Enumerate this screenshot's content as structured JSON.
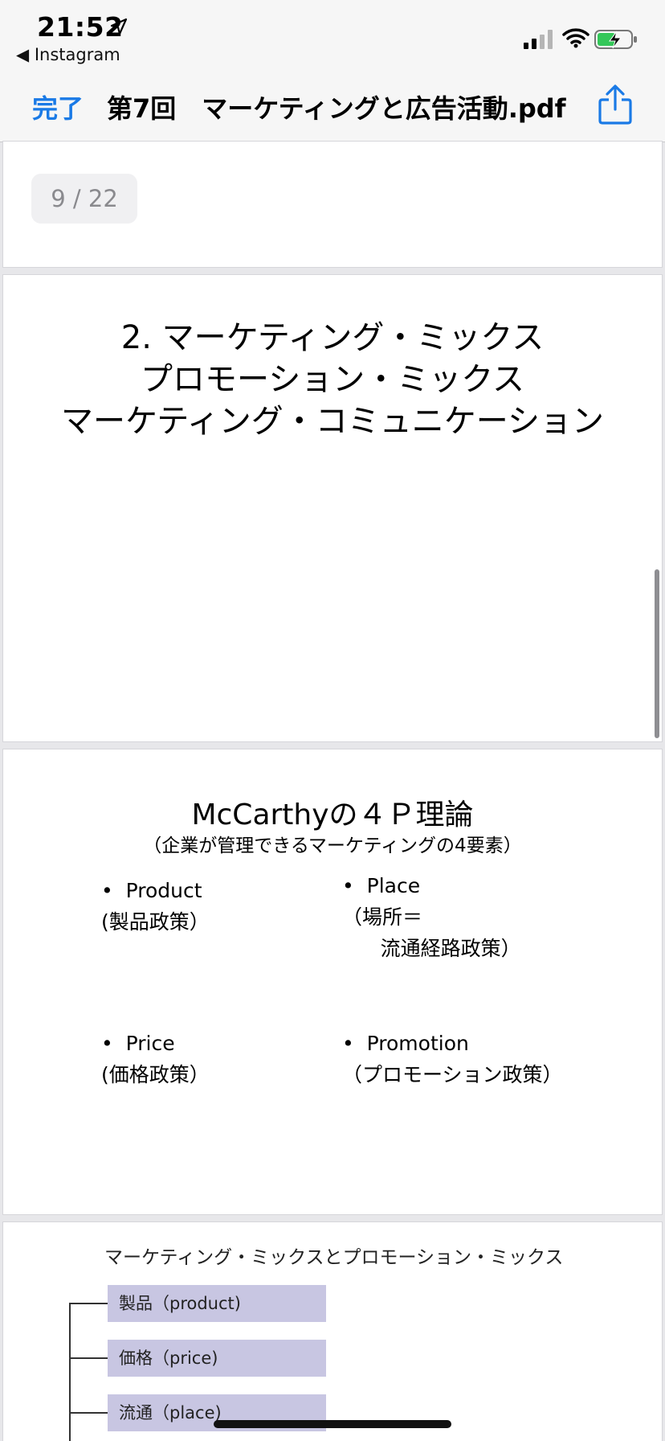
{
  "status_bar": {
    "time": "21:52",
    "back_app": "◀ Instagram",
    "icons": [
      "location-arrow-icon",
      "cellular-signal-icon",
      "wifi-icon",
      "battery-charging-icon"
    ]
  },
  "nav": {
    "done_label": "完了",
    "title": "第7回　マーケティングと広告活動.pdf",
    "share_icon": "share-icon",
    "accent_color": "#1a7ae6"
  },
  "viewer": {
    "page_indicator": "9 / 22"
  },
  "slides": {
    "slide2": {
      "lines": [
        "2. マーケティング・ミックス",
        "プロモーション・ミックス",
        "マーケティング・コミュニケーション"
      ]
    },
    "slide3": {
      "title": "McCarthyの４Ｐ理論",
      "subtitle": "（企業が管理できるマーケティングの4要素）",
      "items": [
        "•  Product\n(製品政策）",
        "•  Place\n（場所＝\n      流通経路政策）",
        "•  Price\n(価格政策）",
        "•  Promotion\n（プロモーション政策）"
      ]
    },
    "slide4": {
      "title": "マーケティング・ミックスとプロモーション・ミックス",
      "boxes": [
        "製品（product)",
        "価格（price)",
        "流通（place)"
      ],
      "box_color": "#c8c6e2"
    }
  }
}
